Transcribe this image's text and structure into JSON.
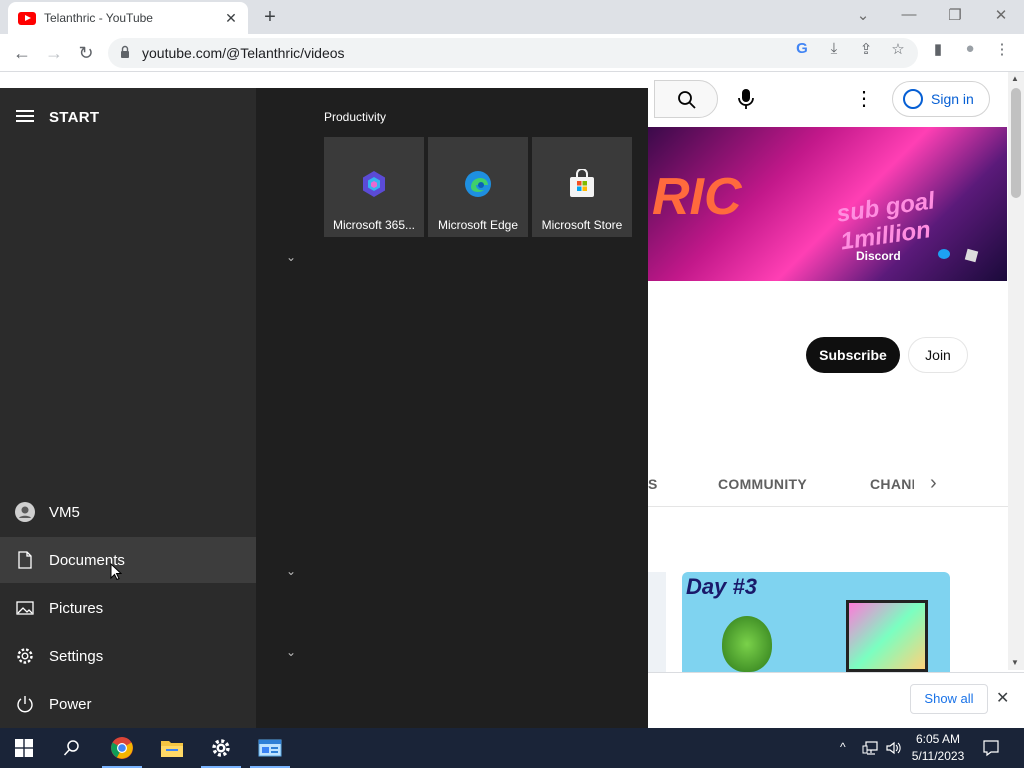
{
  "browser": {
    "tab_title": "Telanthric - YouTube",
    "tab_close": "✕",
    "new_tab": "+",
    "url": "youtube.com/@Telanthric/videos",
    "window_controls": {
      "dropdown": "⌄",
      "minimize": "—",
      "restore": "❐",
      "close": "✕"
    },
    "nav": {
      "back": "←",
      "forward": "→",
      "reload": "↻"
    },
    "omni_icons": {
      "google": "G",
      "install": "⤓",
      "share": "⇪",
      "star": "☆",
      "sidebar": "▮",
      "profile": "●",
      "menu": "⋮"
    }
  },
  "youtube": {
    "sign_in": "Sign in",
    "more": "⋮",
    "banner_text": "RIC",
    "banner_sub": "sub goal 1million",
    "banner_discord": "Discord",
    "subscribe": "Subscribe",
    "join": "Join",
    "tabs": {
      "partial": "S",
      "community": "COMMUNITY",
      "channels": "CHANI"
    },
    "tabs_next": "›",
    "thumb_title": "Day #3",
    "show_all": "Show all",
    "download_close": "✕"
  },
  "start_menu": {
    "title": "START",
    "rail": {
      "user": "VM5",
      "documents": "Documents",
      "pictures": "Pictures",
      "settings": "Settings",
      "power": "Power"
    },
    "group_title": "Productivity",
    "tiles": [
      {
        "label": "Microsoft 365...",
        "icon": "microsoft-365-icon"
      },
      {
        "label": "Microsoft Edge",
        "icon": "edge-icon"
      },
      {
        "label": "Microsoft Store",
        "icon": "store-icon"
      }
    ],
    "expand_glyph": "⌄"
  },
  "taskbar": {
    "time": "6:05 AM",
    "date": "5/11/2023",
    "tray_chevron": "^",
    "pinned": [
      "start-button",
      "search-button",
      "chrome",
      "file-explorer",
      "settings",
      "control-panel"
    ]
  },
  "colors": {
    "start_bg": "#1f1f1f",
    "start_rail": "#2b2b2b",
    "taskbar": "#1a2438",
    "youtube_red": "#ff0000",
    "link_blue": "#065fd4"
  }
}
